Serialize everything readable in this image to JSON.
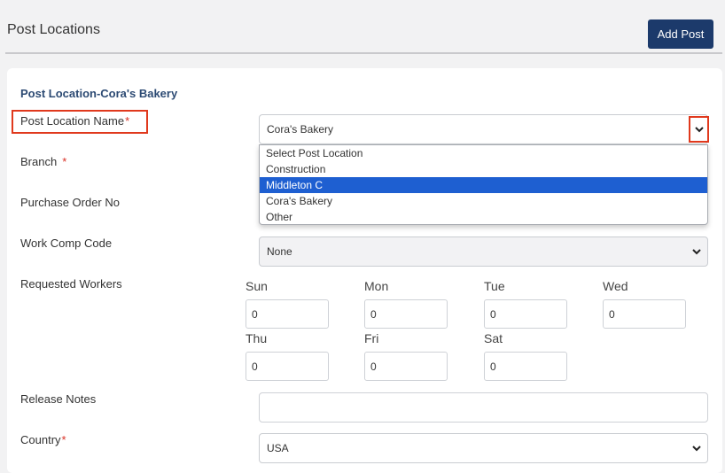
{
  "header": {
    "title": "Post Locations",
    "add_button_label": "Add Post"
  },
  "form": {
    "section_title": "Post Location-Cora's Bakery",
    "required_mark": "*",
    "labels": {
      "post_location_name": "Post Location Name",
      "branch": "Branch",
      "purchase_order_no": "Purchase Order No",
      "work_comp_code": "Work Comp Code",
      "requested_workers": "Requested Workers",
      "release_notes": "Release Notes",
      "country": "Country"
    },
    "post_location_value": "Cora's Bakery",
    "post_location_options": [
      "Select Post Location",
      "Construction",
      "Middleton C",
      "Cora's Bakery",
      "Other"
    ],
    "highlighted_option": "Middleton C",
    "work_comp_code_value": "None",
    "release_notes_value": "",
    "country_value": "USA",
    "requested_workers": {
      "days": [
        "Sun",
        "Mon",
        "Tue",
        "Wed",
        "Thu",
        "Fri",
        "Sat"
      ],
      "values": [
        "0",
        "0",
        "0",
        "0",
        "0",
        "0",
        "0"
      ]
    }
  },
  "colors": {
    "accent": "#1c3a6b",
    "highlight": "#e0391d",
    "selected_option": "#1e5fd1"
  },
  "icons": {
    "select_chevron": "chevron-down-icon"
  }
}
